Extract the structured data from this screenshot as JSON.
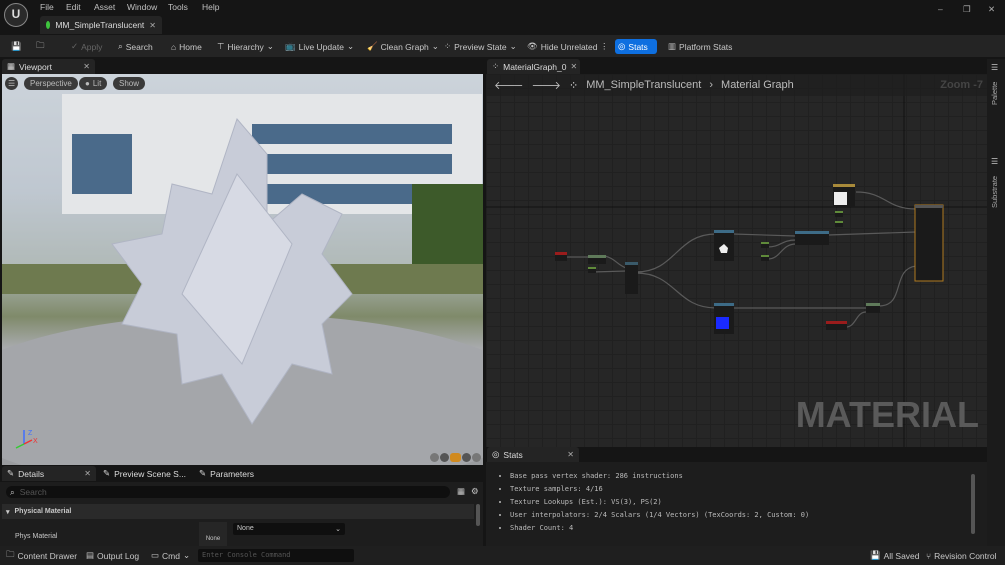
{
  "menu": {
    "items": [
      "File",
      "Edit",
      "Asset",
      "Window",
      "Tools",
      "Help"
    ]
  },
  "window": {
    "tab_title": "MM_SimpleTranslucent",
    "minimize": "–",
    "restore": "❐",
    "close": "✕"
  },
  "toolbar": {
    "apply": "Apply",
    "search": "Search",
    "home": "Home",
    "hierarchy": "Hierarchy",
    "live_update": "Live Update",
    "clean_graph": "Clean Graph",
    "preview_state": "Preview State",
    "hide_unrelated": "Hide Unrelated",
    "stats": "Stats",
    "platform_stats": "Platform Stats"
  },
  "viewport": {
    "tab": "Viewport",
    "perspective": "Perspective",
    "lit": "Lit",
    "show": "Show",
    "axis_x": "X",
    "axis_z": "Z"
  },
  "graph": {
    "tab": "MaterialGraph_0",
    "breadcrumb": [
      "MM_SimpleTranslucent",
      "Material Graph"
    ],
    "zoom": "Zoom -7",
    "watermark": "MATERIAL"
  },
  "sidebar": {
    "palette": "Palette",
    "substrate": "Substrate"
  },
  "stats": {
    "tab": "Stats",
    "lines": [
      "Base pass vertex shader: 286 instructions",
      "Texture samplers: 4/16",
      "Texture Lookups (Est.): VS(3), PS(2)",
      "User interpolators: 2/4 Scalars (1/4 Vectors) (TexCoords: 2, Custom: 0)",
      "Shader Count: 4"
    ]
  },
  "details": {
    "tabs": [
      "Details",
      "Preview Scene S...",
      "Parameters"
    ],
    "search_placeholder": "Search",
    "section": "Physical Material",
    "row_label": "Phys Material",
    "thumb": "None",
    "dropdown": "None"
  },
  "statusbar": {
    "content_drawer": "Content Drawer",
    "output_log": "Output Log",
    "cmd": "Cmd",
    "console_placeholder": "Enter Console Command",
    "all_saved": "All Saved",
    "revision_control": "Revision Control"
  },
  "colors": {
    "accent": "#0e6fe0",
    "output_node_border": "#b07a20"
  }
}
